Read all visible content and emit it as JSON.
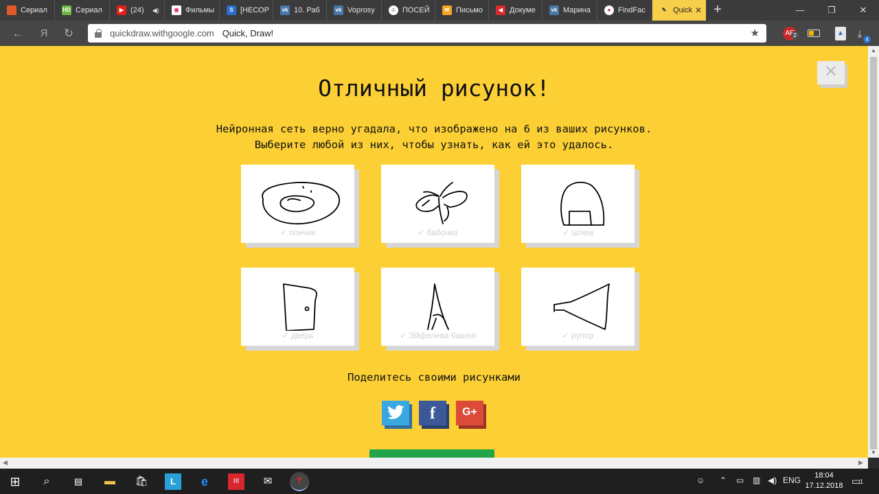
{
  "browser": {
    "tabs": [
      {
        "label": "Сериал",
        "icon_color": "#e05a2b"
      },
      {
        "label": "Сериал",
        "icon_color": "#6cb33f",
        "icon_text": "HD"
      },
      {
        "label": "(24)",
        "icon_color": "#e62117"
      },
      {
        "label": "Фильмы",
        "icon_color": "#e8325a"
      },
      {
        "label": "[НЕСОР",
        "icon_color": "#2a6fcb"
      },
      {
        "label": "10. Раб",
        "icon_color": "#4a76a8"
      },
      {
        "label": "Voprosy",
        "icon_color": "#4a76a8"
      },
      {
        "label": "ПОСЕЙ",
        "icon_color": "#ffffff"
      },
      {
        "label": "Письмо",
        "icon_color": "#f5a623"
      },
      {
        "label": "Докуме",
        "icon_color": "#d92b2b"
      },
      {
        "label": "Марина",
        "icon_color": "#4a76a8"
      },
      {
        "label": "FindFac",
        "icon_color": "#cc2244"
      },
      {
        "label": "Quick",
        "icon_color": "#f7cf4a",
        "active": true
      }
    ],
    "url": "quickdraw.withgoogle.com",
    "page_title": "Quick, Draw!",
    "extension_badge": "2",
    "downloads_badge": "4"
  },
  "page": {
    "title": "Отличный рисунок!",
    "subtitle_line1": "Нейронная сеть верно угадала, что изображено на 6 из ваших рисунков.",
    "subtitle_line2": "Выберите любой из них, чтобы узнать, как ей это удалось.",
    "close_label": "✕",
    "drawings": [
      {
        "label": "✓ пончик"
      },
      {
        "label": "✓ бабочка"
      },
      {
        "label": "✓ шлем"
      },
      {
        "label": "✓ дверь"
      },
      {
        "label": "✓ Эйфелева башня"
      },
      {
        "label": "✓ рупор"
      }
    ],
    "share_title": "Поделитесь своими рисунками",
    "social": [
      {
        "name": "twitter",
        "color": "#3aa8e0"
      },
      {
        "name": "facebook",
        "color": "#3b5998",
        "glyph": "f"
      },
      {
        "name": "google-plus",
        "color": "#dc4a38",
        "glyph": "G+"
      }
    ]
  },
  "taskbar": {
    "lang": "ENG",
    "time": "18:04",
    "date": "17.12.2018",
    "notifications": "1"
  }
}
